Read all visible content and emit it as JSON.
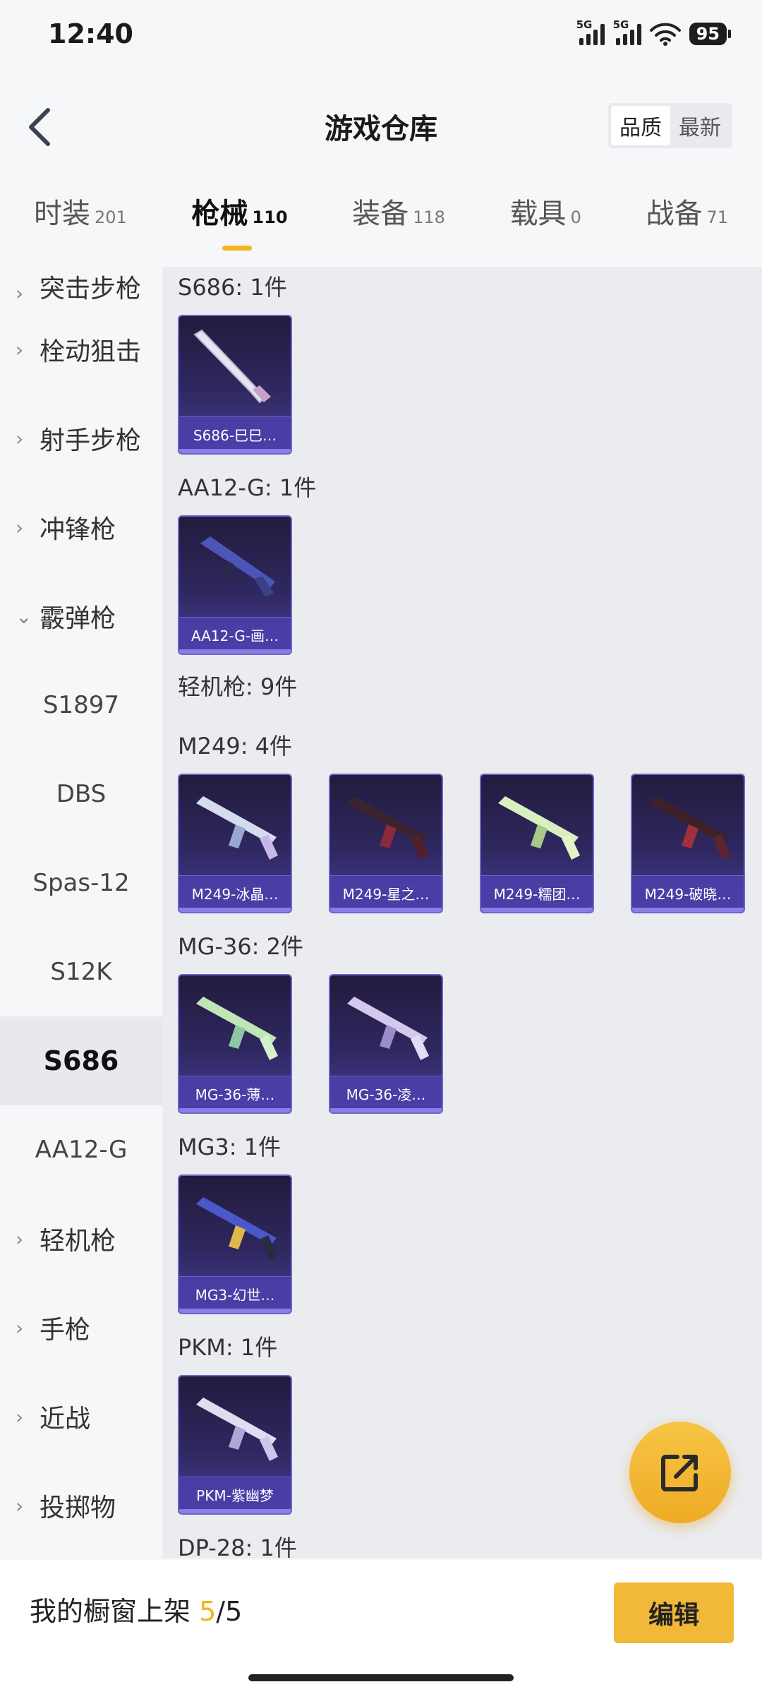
{
  "status": {
    "time": "12:40",
    "net1": "5G",
    "net2": "5G",
    "battery": "95"
  },
  "header": {
    "title": "游戏仓库",
    "sort_options": [
      "品质",
      "最新"
    ]
  },
  "tabs": [
    {
      "label": "时装",
      "count": "201"
    },
    {
      "label": "枪械",
      "count": "110"
    },
    {
      "label": "装备",
      "count": "118"
    },
    {
      "label": "载具",
      "count": "0"
    },
    {
      "label": "战备",
      "count": "71"
    }
  ],
  "sidebar": {
    "items": [
      {
        "label": "突击步枪"
      },
      {
        "label": "栓动狙击"
      },
      {
        "label": "射手步枪"
      },
      {
        "label": "冲锋枪"
      },
      {
        "label": "霰弹枪"
      },
      {
        "label": "S1897"
      },
      {
        "label": "DBS"
      },
      {
        "label": "Spas-12"
      },
      {
        "label": "S12K"
      },
      {
        "label": "S686"
      },
      {
        "label": "AA12-G"
      },
      {
        "label": "轻机枪"
      },
      {
        "label": "手枪"
      },
      {
        "label": "近战"
      },
      {
        "label": "投掷物"
      }
    ]
  },
  "groups": [
    {
      "title": "S686: 1件",
      "items": [
        {
          "label": "S686-巳巳…"
        }
      ]
    },
    {
      "title": "AA12-G: 1件",
      "items": [
        {
          "label": "AA12-G-画…"
        }
      ]
    },
    {
      "title": "轻机枪: 9件",
      "items": []
    },
    {
      "title": "M249: 4件",
      "items": [
        {
          "label": "M249-冰晶…"
        },
        {
          "label": "M249-星之…"
        },
        {
          "label": "M249-糯团…"
        },
        {
          "label": "M249-破晓…"
        }
      ]
    },
    {
      "title": "MG-36: 2件",
      "items": [
        {
          "label": "MG-36-薄…"
        },
        {
          "label": "MG-36-凌…"
        }
      ]
    },
    {
      "title": "MG3: 1件",
      "items": [
        {
          "label": "MG3-幻世…"
        }
      ]
    },
    {
      "title": "PKM: 1件",
      "items": [
        {
          "label": "PKM-紫幽梦"
        }
      ]
    },
    {
      "title": "DP-28: 1件",
      "items": []
    }
  ],
  "bottom": {
    "showcase_prefix": "我的橱窗上架 ",
    "showcase_current": "5",
    "showcase_total": "/5",
    "edit_label": "编辑"
  },
  "colors": {
    "accent": "#f2b51f",
    "card_top": "#221b3d",
    "card_bottom": "#4a3f99",
    "card_border": "#6d63c9"
  }
}
